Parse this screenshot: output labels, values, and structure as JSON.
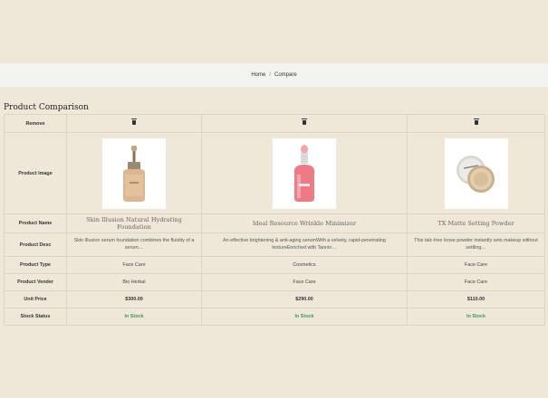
{
  "breadcrumb": {
    "home": "Home",
    "separator": "/",
    "current": "Compare"
  },
  "page": {
    "title": "Product Comparison"
  },
  "rows": {
    "remove": "Remove",
    "image": "Product Image",
    "name": "Product Name",
    "desc": "Product Desc",
    "type": "Product Type",
    "vendor": "Product Vender",
    "price": "Unit Price",
    "stock": "Stock Status"
  },
  "products": [
    {
      "name": "Skin Illusion Natural Hydrating Foundation",
      "desc": "Skin Illusion serum foundation combines the fluidity of a serum…",
      "type": "Face Care",
      "vendor": "Bio Herbal",
      "price": "$300.00",
      "stock": "In Stock",
      "image_icon": "foundation-bottle-icon"
    },
    {
      "name": "Ideal Resource Wrinkle Minimizer",
      "desc": "An effective brightening & anti-aging serumWith a velvety, rapid-penetrating textureEnriched with Tannin…",
      "type": "Cosmetics",
      "vendor": "Face Care",
      "price": "$290.00",
      "stock": "In Stock",
      "image_icon": "serum-bottle-icon"
    },
    {
      "name": "TX Matte Setting Powder",
      "desc": "This talc-free loose powder instantly sets makeup without settling…",
      "type": "Face Care",
      "vendor": "Face Care",
      "price": "$110.00",
      "stock": "In Stock",
      "image_icon": "powder-jar-icon"
    }
  ],
  "colors": {
    "background": "#efe8d8",
    "breadcrumb_bar": "#f3f3f1",
    "in_stock": "#3a9a5a",
    "border": "#ddd5c4"
  }
}
